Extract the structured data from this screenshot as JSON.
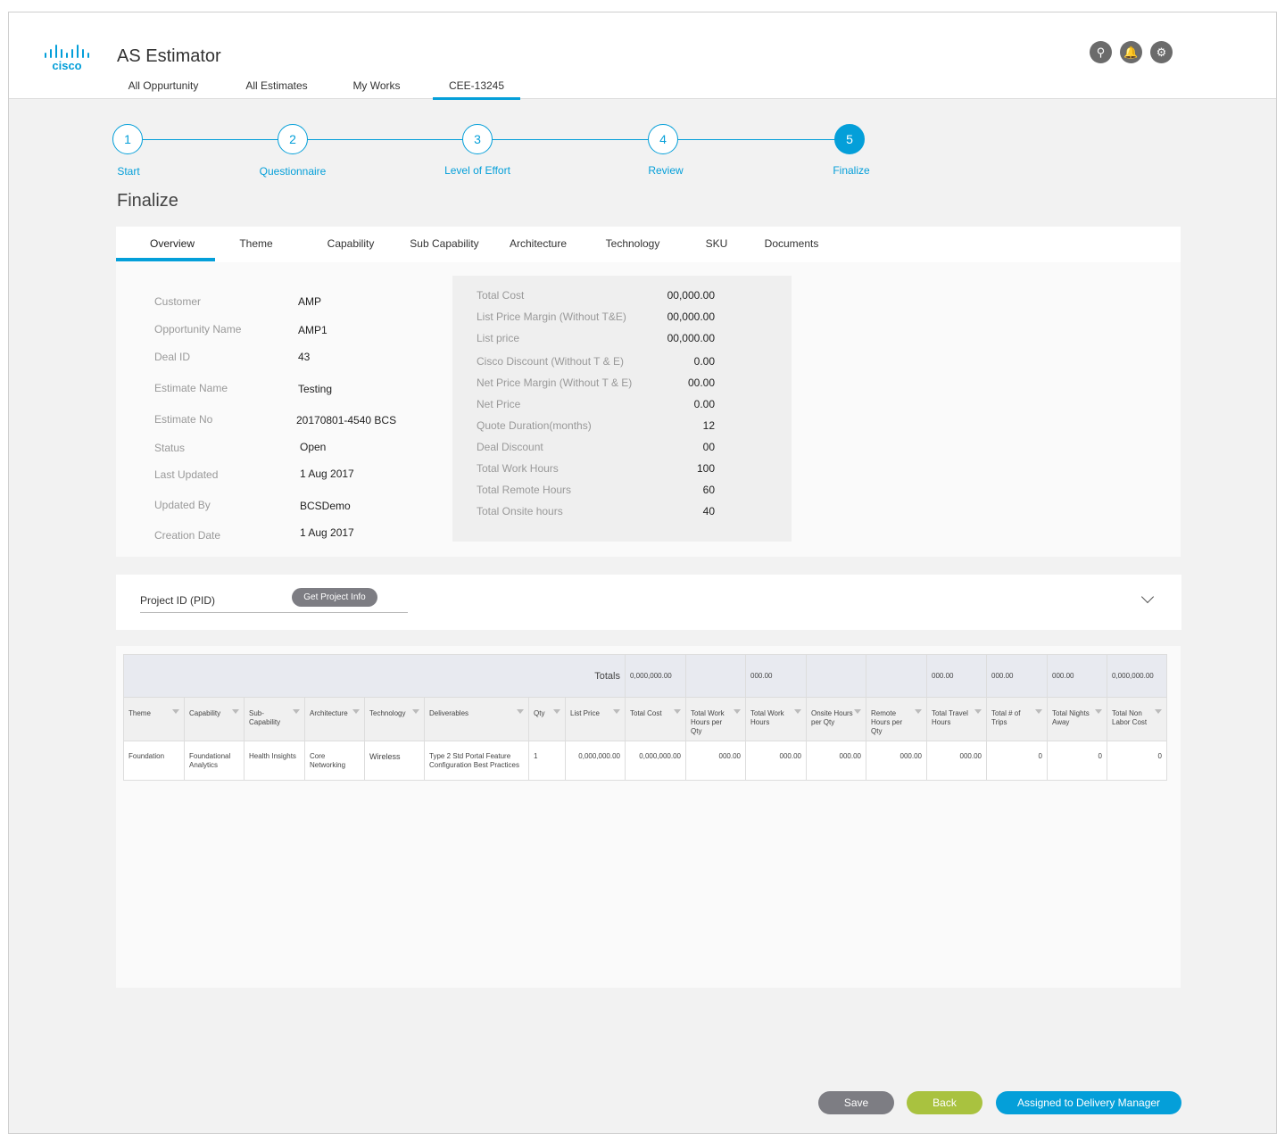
{
  "app": {
    "title": "AS Estimator",
    "logo": "cisco"
  },
  "nav": [
    "All Oppurtunity",
    "All Estimates",
    "My Works",
    "CEE-13245"
  ],
  "header_icons": [
    "search-icon",
    "bell-icon",
    "gear-icon"
  ],
  "steps": [
    {
      "num": "1",
      "label": "Start"
    },
    {
      "num": "2",
      "label": "Questionnaire"
    },
    {
      "num": "3",
      "label": "Level of Effort"
    },
    {
      "num": "4",
      "label": "Review"
    },
    {
      "num": "5",
      "label": "Finalize"
    }
  ],
  "page_title": "Finalize",
  "tabs": [
    "Overview",
    "Theme",
    "Capability",
    "Sub Capability",
    "Architecture",
    "Technology",
    "SKU",
    "Documents"
  ],
  "details": [
    {
      "label": "Customer",
      "value": "AMP"
    },
    {
      "label": "Opportunity Name",
      "value": "AMP1"
    },
    {
      "label": "Deal ID",
      "value": "43"
    },
    {
      "label": "Estimate Name",
      "value": "Testing"
    },
    {
      "label": "Estimate No",
      "value": "20170801-4540 BCS"
    },
    {
      "label": "Status",
      "value": "Open"
    },
    {
      "label": "Last Updated",
      "value": "1 Aug 2017"
    },
    {
      "label": "Updated By",
      "value": "BCSDemo"
    },
    {
      "label": "Creation Date",
      "value": "1 Aug 2017"
    }
  ],
  "summary": [
    {
      "label": "Total Cost",
      "value": "00,000.00"
    },
    {
      "label": "List Price Margin (Without T&E)",
      "value": "00,000.00"
    },
    {
      "label": "List price",
      "value": "00,000.00"
    },
    {
      "label": "Cisco Discount (Without T & E)",
      "value": "0.00"
    },
    {
      "label": "Net Price Margin (Without T & E)",
      "value": "00.00"
    },
    {
      "label": "Net Price",
      "value": "0.00"
    },
    {
      "label": "Quote Duration(months)",
      "value": "12"
    },
    {
      "label": "Deal Discount",
      "value": "00"
    },
    {
      "label": "Total Work Hours",
      "value": "100"
    },
    {
      "label": "Total Remote Hours",
      "value": "60"
    },
    {
      "label": "Total Onsite hours",
      "value": "40"
    }
  ],
  "pid": {
    "label": "Project ID (PID)",
    "button": "Get Project Info"
  },
  "table": {
    "totals_label": "Totals",
    "totals": [
      "0,000,000.00",
      "",
      "000.00",
      "",
      "",
      "000.00",
      "000.00",
      "000.00",
      "0,000,000.00"
    ],
    "columns": [
      "Theme",
      "Capability",
      "Sub-Capability",
      "Architecture",
      "Technology",
      "Deliverables",
      "Qty",
      "List Price",
      "Total Cost",
      "Total Work Hours per Qty",
      "Total Work Hours",
      "Onsite Hours per Qty",
      "Remote Hours per Qty",
      "Total Travel Hours",
      "Total # of Trips",
      "Total Nights Away",
      "Total Non Labor Cost"
    ],
    "rows": [
      [
        "Foundation",
        "Foundational Analytics",
        "Health Insights",
        "Core Networking",
        "Wireless",
        "Type 2 Std Portal Feature Configuration Best Practices",
        "1",
        "0,000,000.00",
        "0,000,000.00",
        "000.00",
        "000.00",
        "000.00",
        "000.00",
        "000.00",
        "0",
        "0",
        "0"
      ]
    ]
  },
  "buttons": {
    "save": "Save",
    "back": "Back",
    "assign": "Assigned to Delivery Manager"
  },
  "colors": {
    "accent": "#049fd9",
    "back": "#a9c23f",
    "save": "#7d7d83"
  }
}
